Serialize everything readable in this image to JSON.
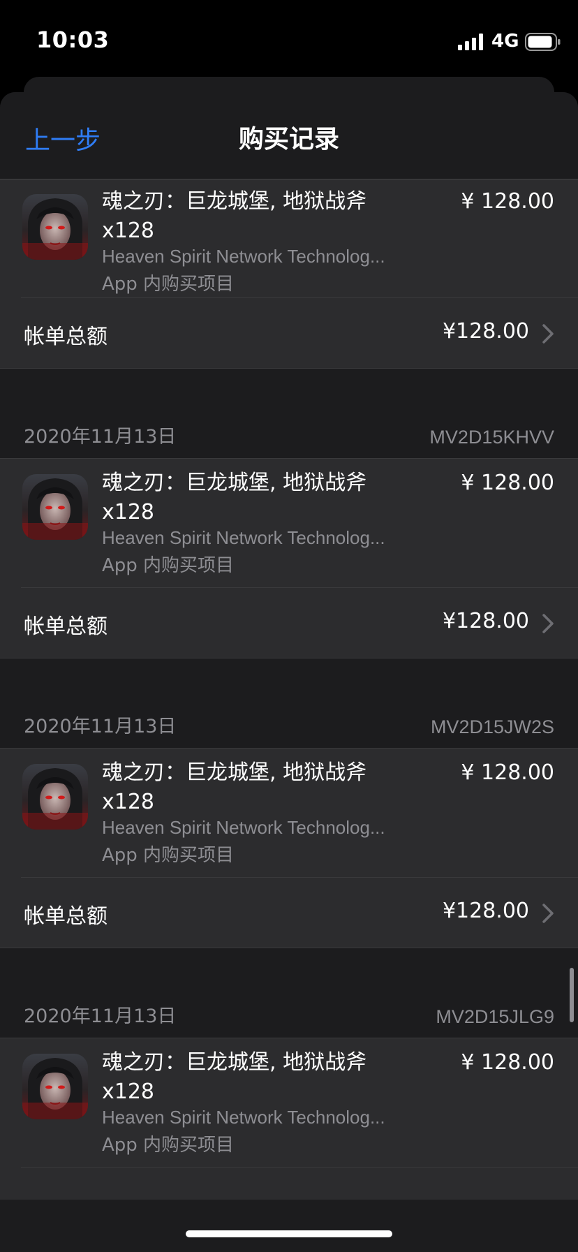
{
  "status_bar": {
    "time": "10:03",
    "network": "4G",
    "signal_icon": "cellular-signal-icon",
    "battery_icon": "battery-icon"
  },
  "nav": {
    "back_label": "上一步",
    "title": "购买记录"
  },
  "colors": {
    "accent": "#2f7df6",
    "sheet_bg": "#1c1c1e",
    "card_bg": "#2c2c2e",
    "secondary_text": "#8e8e93"
  },
  "groups": [
    {
      "date": "",
      "order_id": "",
      "item": {
        "title": "魂之刃：巨龙城堡, 地狱战斧 x128",
        "price": "¥ 128.00",
        "developer": "Heaven Spirit Network Technolog...",
        "type": "App 内购买项目"
      },
      "total_label": "帐单总额",
      "total_amount": "¥128.00"
    },
    {
      "date": "2020年11月13日",
      "order_id": "MV2D15KHVV",
      "item": {
        "title": "魂之刃：巨龙城堡, 地狱战斧 x128",
        "price": "¥ 128.00",
        "developer": "Heaven Spirit Network Technolog...",
        "type": "App 内购买项目"
      },
      "total_label": "帐单总额",
      "total_amount": "¥128.00"
    },
    {
      "date": "2020年11月13日",
      "order_id": "MV2D15JW2S",
      "item": {
        "title": "魂之刃：巨龙城堡, 地狱战斧 x128",
        "price": "¥ 128.00",
        "developer": "Heaven Spirit Network Technolog...",
        "type": "App 内购买项目"
      },
      "total_label": "帐单总额",
      "total_amount": "¥128.00"
    },
    {
      "date": "2020年11月13日",
      "order_id": "MV2D15JLG9",
      "item": {
        "title": "魂之刃：巨龙城堡, 地狱战斧 x128",
        "price": "¥ 128.00",
        "developer": "Heaven Spirit Network Technolog...",
        "type": "App 内购买项目"
      }
    }
  ]
}
